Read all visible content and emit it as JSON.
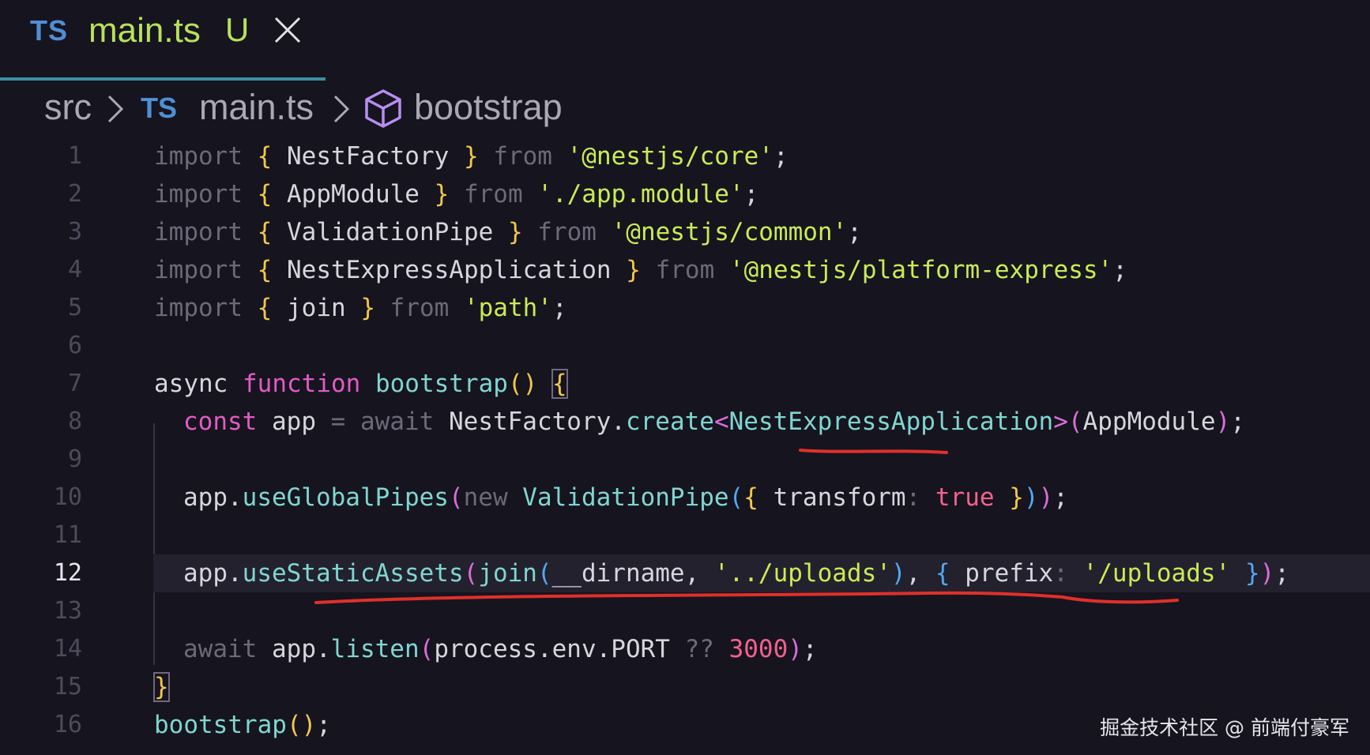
{
  "tab": {
    "lang_badge": "TS",
    "filename": "main.ts",
    "status": "U"
  },
  "breadcrumb": {
    "folder": "src",
    "lang_badge": "TS",
    "file": "main.ts",
    "symbol": "bootstrap"
  },
  "editor": {
    "current_line": 12,
    "line_numbers": [
      "1",
      "2",
      "3",
      "4",
      "5",
      "6",
      "7",
      "8",
      "9",
      "10",
      "11",
      "12",
      "13",
      "14",
      "15",
      "16"
    ],
    "lines": {
      "l1": [
        "import",
        " ",
        "{",
        " NestFactory ",
        "}",
        " ",
        "from",
        " ",
        "'@nestjs/core'",
        ";"
      ],
      "l2": [
        "import",
        " ",
        "{",
        " AppModule ",
        "}",
        " ",
        "from",
        " ",
        "'./app.module'",
        ";"
      ],
      "l3": [
        "import",
        " ",
        "{",
        " ValidationPipe ",
        "}",
        " ",
        "from",
        " ",
        "'@nestjs/common'",
        ";"
      ],
      "l4": [
        "import",
        " ",
        "{",
        " NestExpressApplication ",
        "}",
        " ",
        "from",
        " ",
        "'@nestjs/platform-express'",
        ";"
      ],
      "l5": [
        "import",
        " ",
        "{",
        " join ",
        "}",
        " ",
        "from",
        " ",
        "'path'",
        ";"
      ],
      "l7": [
        "async",
        " ",
        "function",
        " ",
        "bootstrap",
        "()",
        " ",
        "{"
      ],
      "l8": [
        "const",
        " app ",
        "=",
        " ",
        "await",
        " NestFactory.",
        "create",
        "<",
        "NestExpressApplication",
        ">",
        "(",
        "AppModule",
        ")",
        ";"
      ],
      "l10": [
        "app.",
        "useGlobalPipes",
        "(",
        "new",
        " ",
        "ValidationPipe",
        "(",
        "{",
        " transform",
        ":",
        " ",
        "true",
        " ",
        "}",
        ")",
        ")",
        ";"
      ],
      "l12": [
        "app.",
        "useStaticAssets",
        "(",
        "join",
        "(",
        "__dirname, ",
        "'../uploads'",
        ")",
        ", ",
        "{",
        " prefix",
        ":",
        " ",
        "'/uploads'",
        " ",
        "}",
        ")",
        ";"
      ],
      "l14": [
        "await",
        " app.",
        "listen",
        "(",
        "process.env.PORT ",
        "??",
        " ",
        "3000",
        ")",
        ";"
      ],
      "l15": [
        "}"
      ],
      "l16": [
        "bootstrap",
        "()",
        ";"
      ]
    }
  },
  "watermark": "掘金技术社区 @ 前端付豪军",
  "colors": {
    "background": "#16141f",
    "string": "#c9ec55",
    "function": "#7fd6d0",
    "keyword": "#e25bc2",
    "number": "#f3618d",
    "annotation": "#e0302a"
  }
}
